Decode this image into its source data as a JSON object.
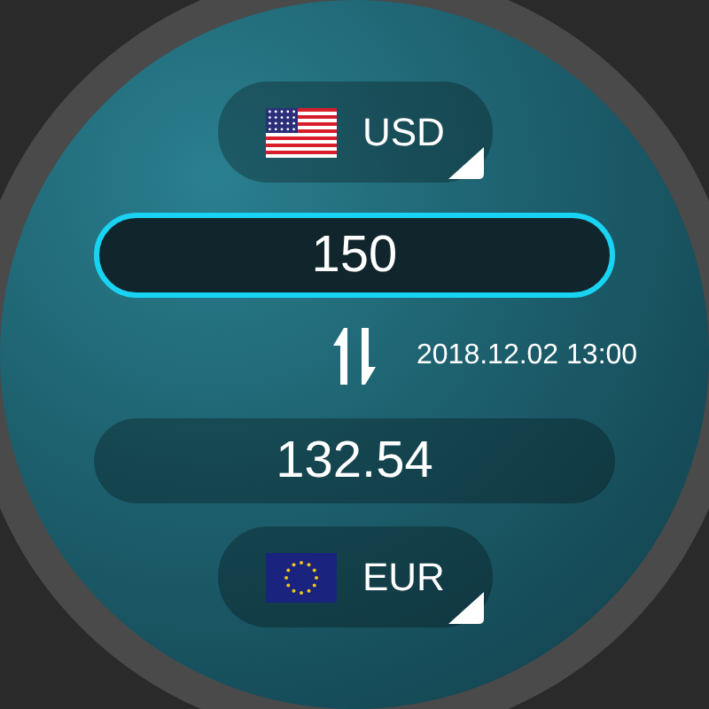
{
  "from_currency": {
    "kind": "us",
    "code": "USD"
  },
  "amount": {
    "value": "150",
    "focused": true
  },
  "timestamp": "2018.12.02 13:00",
  "result": {
    "value": "132.54"
  },
  "to_currency": {
    "kind": "eu",
    "code": "EUR"
  }
}
